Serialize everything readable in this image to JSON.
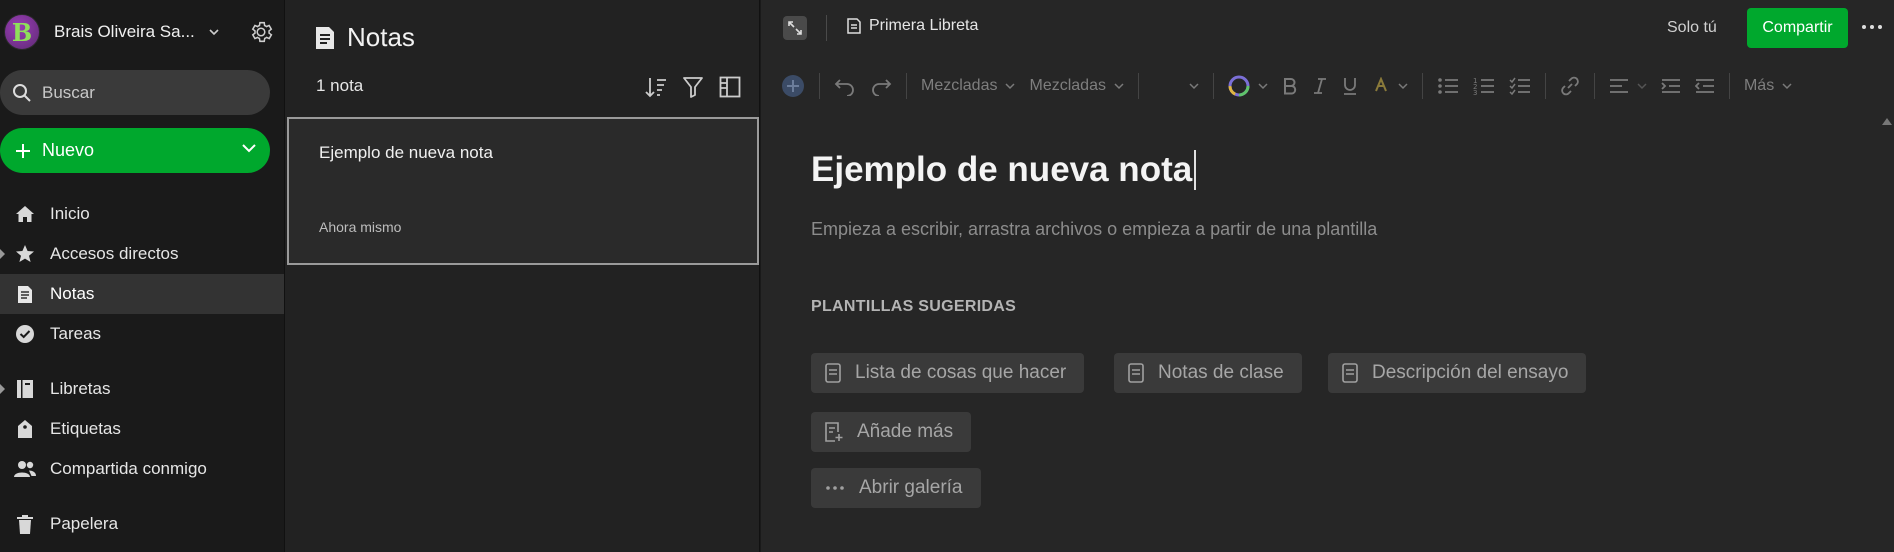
{
  "sidebar": {
    "account": {
      "initial": "B",
      "name": "Brais Oliveira Sa..."
    },
    "search": {
      "placeholder": "Buscar"
    },
    "new_button": {
      "label": "Nuevo"
    },
    "nav": [
      {
        "label": "Inicio",
        "icon": "home-icon"
      },
      {
        "label": "Accesos directos",
        "icon": "star-icon"
      },
      {
        "label": "Notas",
        "icon": "note-icon",
        "active": true
      },
      {
        "label": "Tareas",
        "icon": "check-circle-icon"
      },
      {
        "label": "Libretas",
        "icon": "notebook-icon"
      },
      {
        "label": "Etiquetas",
        "icon": "tag-icon"
      },
      {
        "label": "Compartida conmigo",
        "icon": "people-icon"
      },
      {
        "label": "Papelera",
        "icon": "trash-icon"
      }
    ]
  },
  "note_list": {
    "title": "Notas",
    "count": "1 nota",
    "notes": [
      {
        "title": "Ejemplo de nueva nota",
        "date": "Ahora mismo"
      }
    ]
  },
  "editor": {
    "notebook": "Primera Libreta",
    "share_scope": "Solo tú",
    "share_label": "Compartir",
    "toolbar": {
      "font_family": "Mezcladas",
      "font_size": "Mezcladas",
      "more_label": "Más"
    },
    "note_title": "Ejemplo de nueva nota",
    "hint": "Empieza a escribir, arrastra archivos o empieza a partir de una plantilla",
    "templates_heading": "PLANTILLAS SUGERIDAS",
    "templates": [
      {
        "label": "Lista de cosas que hacer",
        "icon": "template-icon"
      },
      {
        "label": "Notas de clase",
        "icon": "template-icon"
      },
      {
        "label": "Descripción del ensayo",
        "icon": "template-icon"
      },
      {
        "label": "Añade más",
        "icon": "add-template-icon"
      },
      {
        "label": "Abrir galería",
        "icon": "more-dots-icon"
      }
    ]
  },
  "colors": {
    "accent": "#00a82d",
    "sidebar_bg": "#1a1a1a",
    "list_bg": "#222222",
    "editor_bg": "#262626"
  }
}
